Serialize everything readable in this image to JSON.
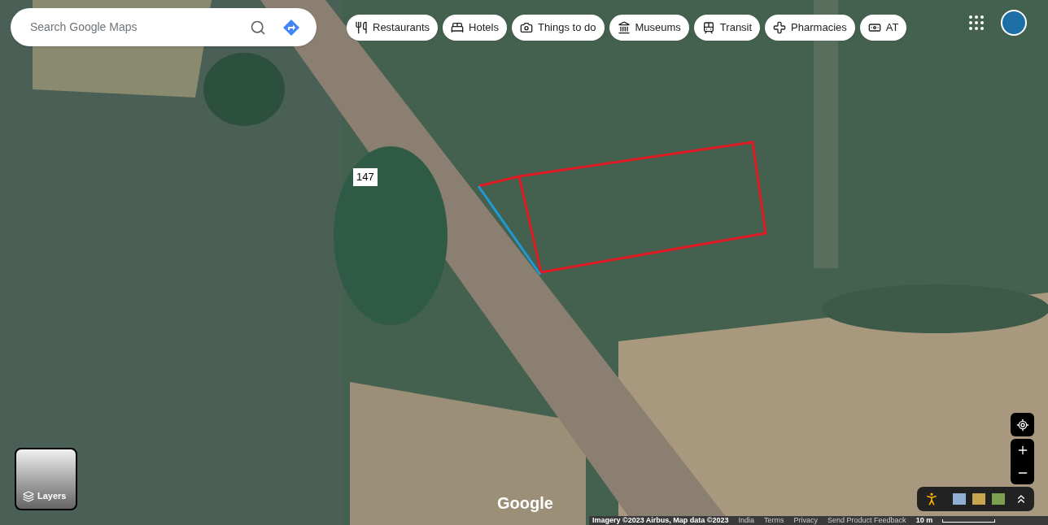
{
  "search": {
    "placeholder": "Search Google Maps"
  },
  "chips": [
    {
      "label": "Restaurants",
      "kind": "restaurant"
    },
    {
      "label": "Hotels",
      "kind": "hotel"
    },
    {
      "label": "Things to do",
      "kind": "camera"
    },
    {
      "label": "Museums",
      "kind": "museum"
    },
    {
      "label": "Transit",
      "kind": "transit"
    },
    {
      "label": "Pharmacies",
      "kind": "pharmacy"
    },
    {
      "label": "AT",
      "kind": "atm"
    }
  ],
  "route_marker": "147",
  "layers_button": {
    "label": "Layers"
  },
  "logo": "Google",
  "footer": {
    "attribution": "Imagery ©2023 Airbus, Map data ©2023",
    "links": [
      "India",
      "Terms",
      "Privacy",
      "Send Product Feedback"
    ],
    "scale": "10 m"
  }
}
